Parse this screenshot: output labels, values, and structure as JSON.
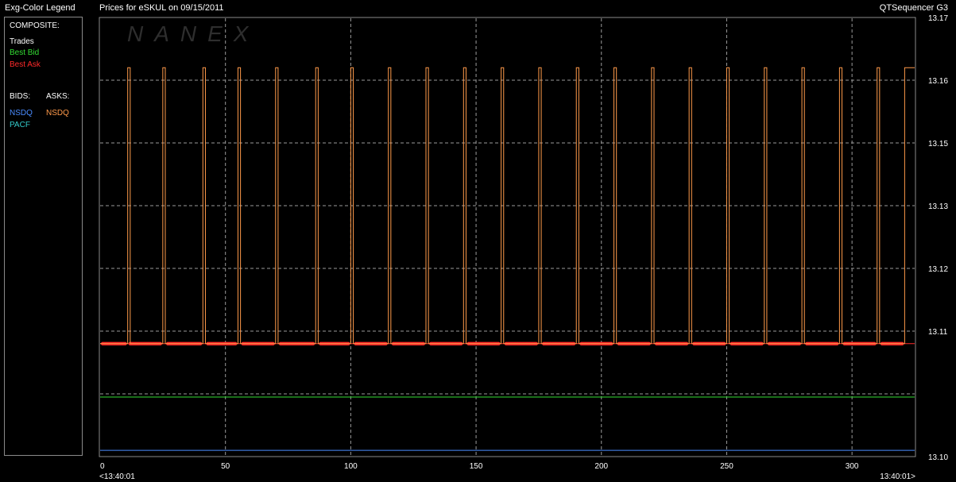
{
  "header": {
    "legend_title": "Exg-Color Legend",
    "chart_title": "Prices for  eSKUL  on  09/15/2011",
    "app_name": "QTSequencer G3"
  },
  "legend": {
    "composite_heading": "COMPOSITE:",
    "composite_items": [
      {
        "label": "Trades",
        "color": "#ffffff"
      },
      {
        "label": "Best Bid",
        "color": "#33dd33"
      },
      {
        "label": "Best Ask",
        "color": "#ff2a2a"
      }
    ],
    "bids_heading": "BIDS:",
    "asks_heading": "ASKS:",
    "bids_items": [
      {
        "label": "NSDQ",
        "color": "#4a8cff"
      },
      {
        "label": "PACF",
        "color": "#33cccc"
      }
    ],
    "asks_items": [
      {
        "label": "NSDQ",
        "color": "#ff9a4a"
      }
    ]
  },
  "watermark": "NANEX",
  "chart_data": {
    "type": "line",
    "xlim": [
      0,
      325
    ],
    "ylim": [
      13.1,
      13.17
    ],
    "x_ticks": [
      0,
      50,
      100,
      150,
      200,
      250,
      300
    ],
    "y_tick_labels": [
      "13.17",
      "13.16",
      "13.15",
      "13.13",
      "13.12",
      "13.11",
      "13.10"
    ],
    "y_tick_values": [
      13.17,
      13.16,
      13.15,
      13.14,
      13.13,
      13.12,
      13.11,
      13.1
    ],
    "time_start_label": "<13:40:01",
    "time_end_label": "13:40:01>",
    "grid": true,
    "series": [
      {
        "name": "Best Ask",
        "color": "#ff2a2a",
        "kind": "flat_markers",
        "value": 13.118,
        "segments": [
          [
            1,
            10
          ],
          [
            12,
            24
          ],
          [
            27,
            40
          ],
          [
            43,
            54
          ],
          [
            57,
            69
          ],
          [
            72,
            85
          ],
          [
            88,
            99
          ],
          [
            102,
            114
          ],
          [
            117,
            129
          ],
          [
            132,
            144
          ],
          [
            147,
            159
          ],
          [
            162,
            174
          ],
          [
            177,
            189
          ],
          [
            192,
            204
          ],
          [
            207,
            219
          ],
          [
            222,
            234
          ],
          [
            237,
            249
          ],
          [
            252,
            264
          ],
          [
            267,
            279
          ],
          [
            282,
            294
          ],
          [
            297,
            309
          ],
          [
            312,
            320
          ]
        ]
      },
      {
        "name": "NSDQ Ask",
        "color": "#ff9a4a",
        "kind": "step",
        "low": 13.118,
        "high": 13.162,
        "spikes": [
          [
            11,
            12
          ],
          [
            25,
            26
          ],
          [
            41,
            42
          ],
          [
            55,
            56
          ],
          [
            70,
            71
          ],
          [
            86,
            87
          ],
          [
            100,
            101
          ],
          [
            115,
            116
          ],
          [
            130,
            131
          ],
          [
            145,
            146
          ],
          [
            160,
            161
          ],
          [
            175,
            176
          ],
          [
            190,
            191
          ],
          [
            205,
            206
          ],
          [
            220,
            221
          ],
          [
            235,
            236
          ],
          [
            250,
            251
          ],
          [
            265,
            266
          ],
          [
            280,
            281
          ],
          [
            295,
            296
          ],
          [
            310,
            311
          ],
          [
            321,
            325
          ]
        ]
      },
      {
        "name": "Best Bid",
        "color": "#33dd33",
        "kind": "flat",
        "value": 13.1095
      },
      {
        "name": "NSDQ Bid",
        "color": "#4a8cff",
        "kind": "flat",
        "value": 13.101
      }
    ]
  }
}
